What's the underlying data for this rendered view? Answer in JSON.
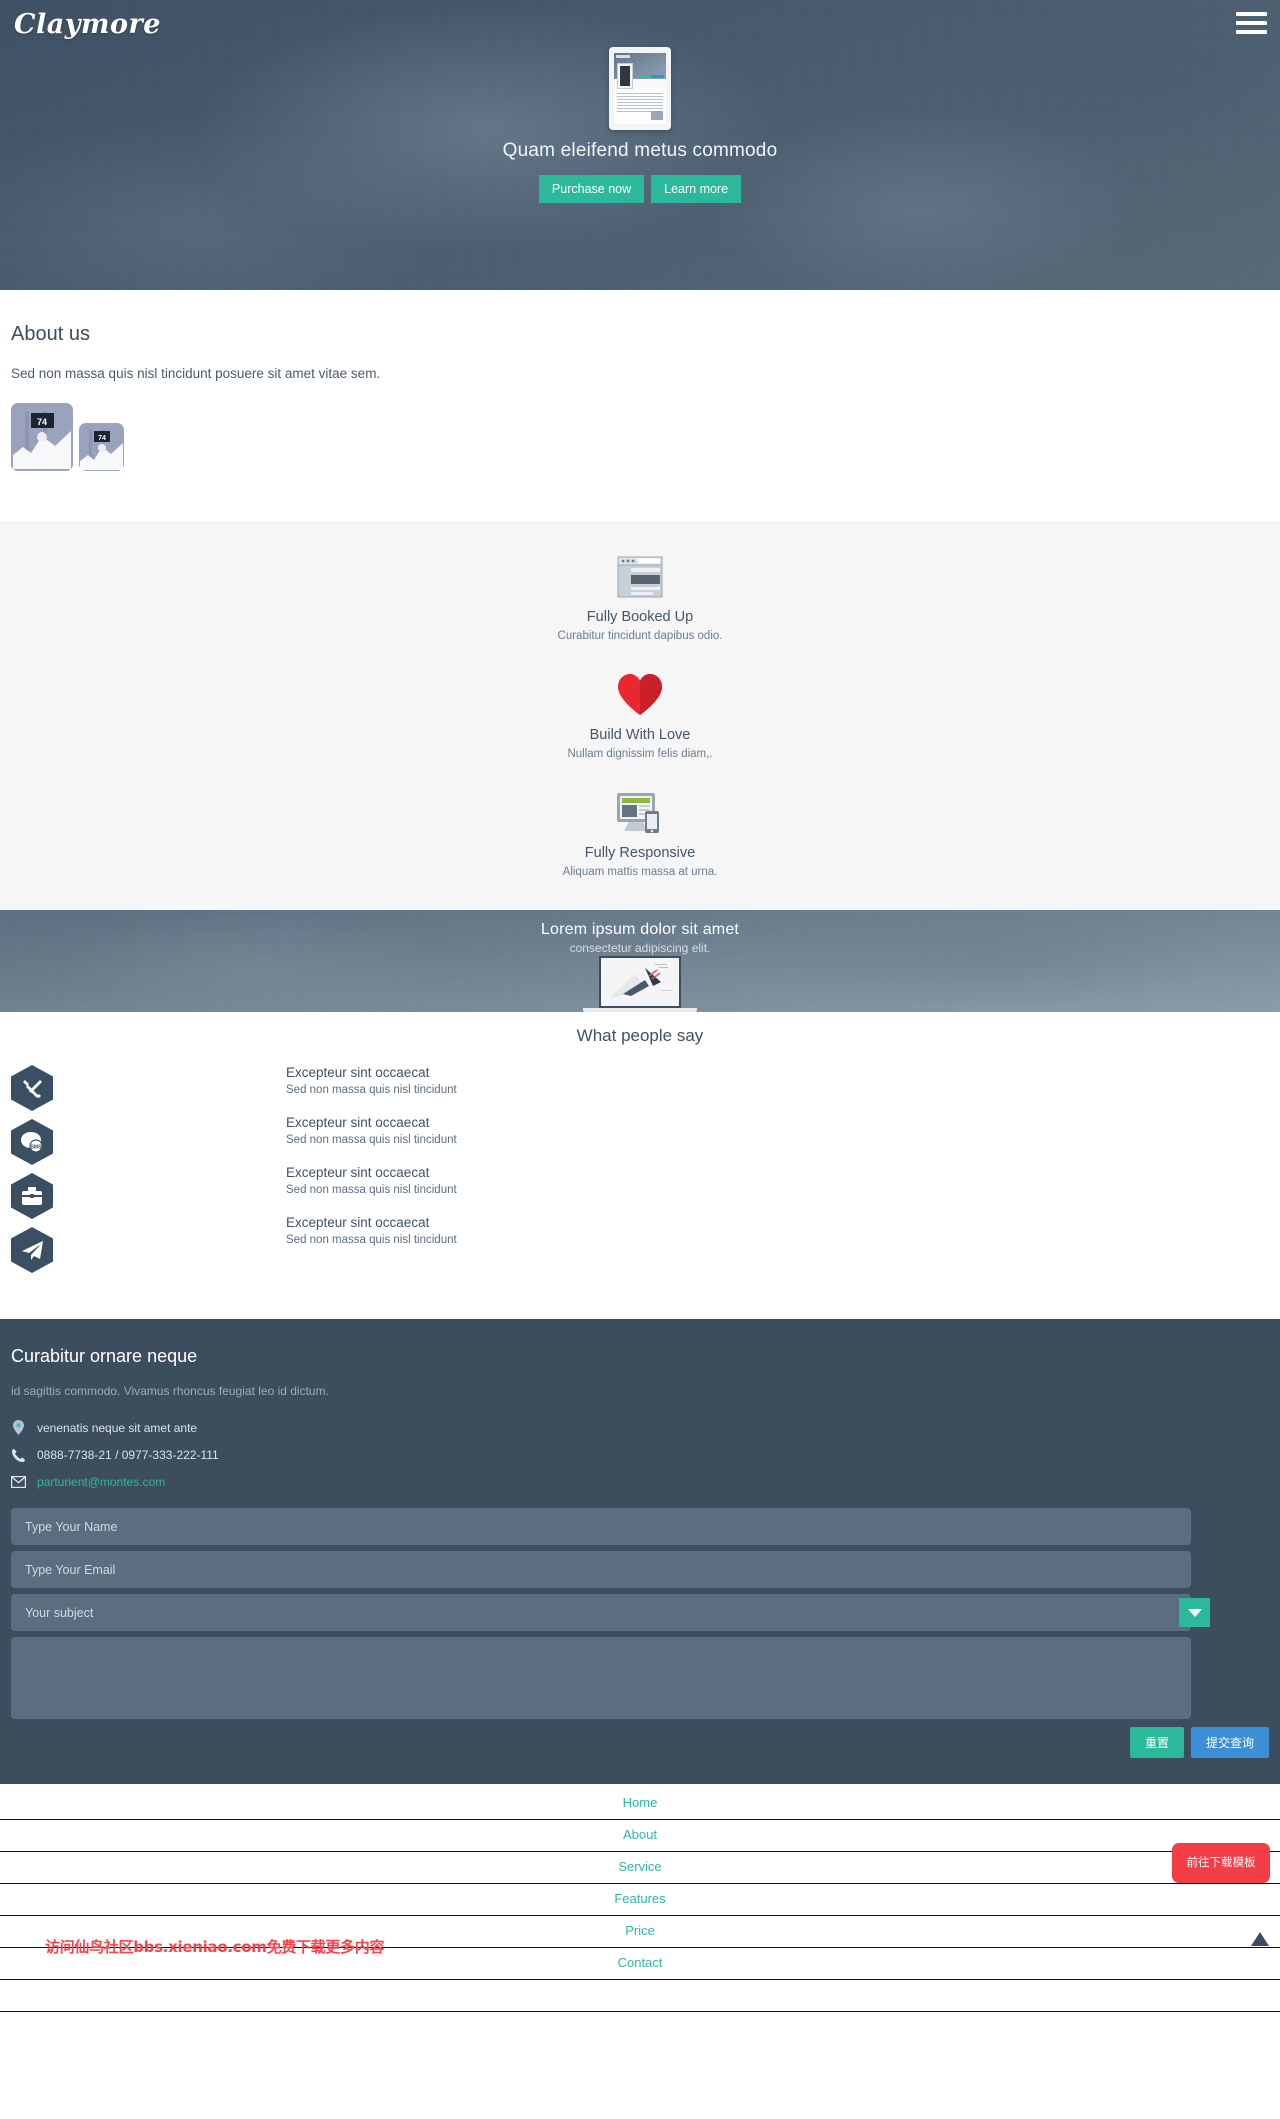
{
  "header": {
    "brand": "Claymore",
    "menu_icon": "hamburger-menu-icon"
  },
  "hero": {
    "title": "Quam eleifend metus commodo",
    "buttons": [
      {
        "label": "Purchase now"
      },
      {
        "label": "Learn more"
      }
    ]
  },
  "about": {
    "heading": "About us",
    "text": "Sed non massa quis nisl tincidunt posuere sit amet vitae sem.",
    "placeholder_badge": "74"
  },
  "features": [
    {
      "icon": "browser-window-icon",
      "title": "Fully Booked Up",
      "text": "Curabitur tincidunt dapibus odio."
    },
    {
      "icon": "heart-icon",
      "title": "Build With Love",
      "text": "Nullam dignissim felis diam,."
    },
    {
      "icon": "responsive-devices-icon",
      "title": "Fully Responsive",
      "text": "Aliquam mattis massa at urna."
    }
  ],
  "parallax": {
    "title": "Lorem ipsum dolor sit amet",
    "subtitle": "consectetur adipiscing elit."
  },
  "testimonials": {
    "heading": "What people say",
    "icons": [
      "tools-icon",
      "sms-chat-icon",
      "briefcase-icon",
      "paper-plane-icon"
    ],
    "items": [
      {
        "title": "Excepteur sint occaecat",
        "text": "Sed non massa quis nisl tincidunt"
      },
      {
        "title": "Excepteur sint occaecat",
        "text": "Sed non massa quis nisl tincidunt"
      },
      {
        "title": "Excepteur sint occaecat",
        "text": "Sed non massa quis nisl tincidunt"
      },
      {
        "title": "Excepteur sint occaecat",
        "text": "Sed non massa quis nisl tincidunt"
      }
    ]
  },
  "contact": {
    "heading": "Curabitur ornare neque",
    "lead": "id sagittis commodo. Vivamus rhoncus feugiat leo id dictum.",
    "address": "venenatis neque sit amet ante",
    "phone": "0888-7738-21 / 0977-333-222-111",
    "email": "parturient@montes.com",
    "form": {
      "name_placeholder": "Type Your Name",
      "email_placeholder": "Type Your Email",
      "subject_placeholder": "Your subject",
      "reset_label": "重置",
      "submit_label": "提交查询"
    }
  },
  "bottom_nav": {
    "links": [
      "Home",
      "About",
      "Service",
      "Features",
      "Price",
      "Contact"
    ],
    "download_label": "前往下载模板",
    "watermark": "访问仙鸟社区bbs.xieniao.com免费下载更多内容",
    "to_top_icon": "arrow-up-icon"
  },
  "colors": {
    "accent_teal": "#2cb99b",
    "accent_blue": "#3b8fd4",
    "dark_navy": "#3c4d5e",
    "red": "#f43e47"
  }
}
